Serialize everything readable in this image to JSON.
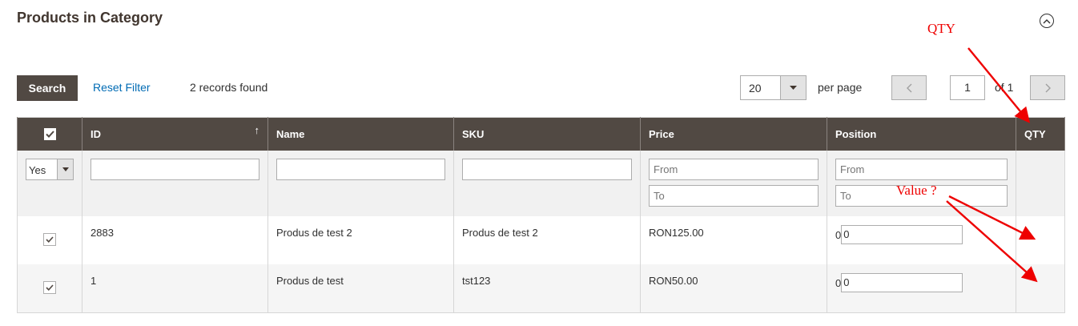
{
  "section": {
    "title": "Products in Category"
  },
  "toolbar": {
    "search_label": "Search",
    "reset_label": "Reset Filter",
    "records_text": "2 records found",
    "per_page_value": "20",
    "per_page_label": "per page",
    "page_current": "1",
    "page_of": "of 1"
  },
  "grid": {
    "columns": [
      "ID",
      "Name",
      "SKU",
      "Price",
      "Position",
      "QTY"
    ],
    "filters": {
      "in_category_value": "Yes",
      "price_from_placeholder": "From",
      "price_to_placeholder": "To",
      "position_from_placeholder": "From",
      "position_to_placeholder": "To"
    },
    "rows": [
      {
        "id": "2883",
        "name": "Produs de test 2",
        "sku": "Produs de test 2",
        "price": "RON125.00",
        "position_prefix": "0",
        "position_value": "0",
        "qty": ""
      },
      {
        "id": "1",
        "name": "Produs de test",
        "sku": "tst123",
        "price": "RON50.00",
        "position_prefix": "0",
        "position_value": "0",
        "qty": ""
      }
    ]
  },
  "annotations": {
    "qty_label": "QTY",
    "value_label": "Value ?",
    "color": "#ee0000"
  },
  "colors": {
    "header_bg": "#514943",
    "link": "#006bb4",
    "filter_bg": "#f1f1f1"
  }
}
